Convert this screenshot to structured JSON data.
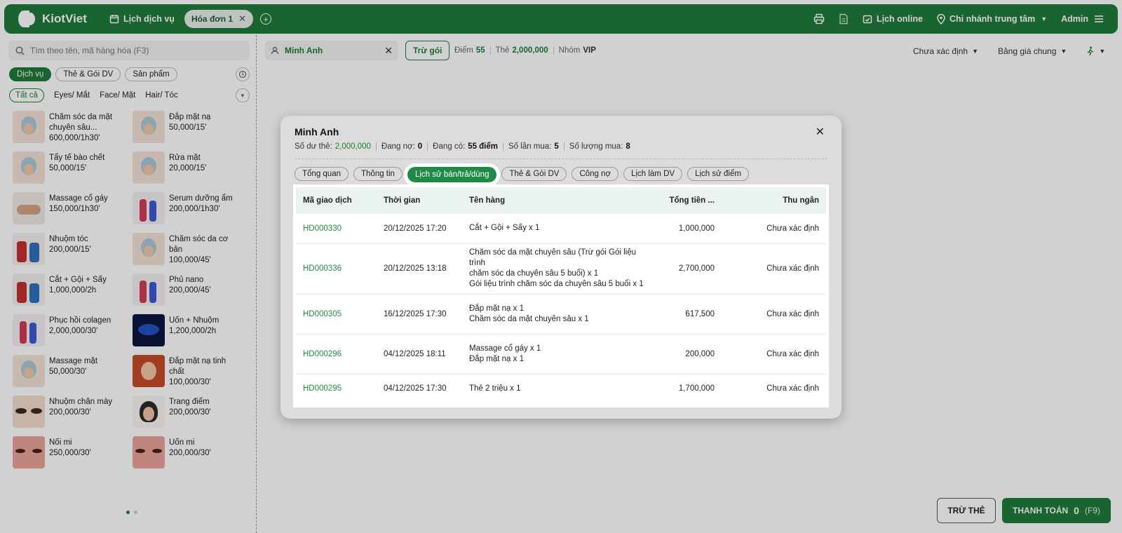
{
  "app": {
    "brand": "KiotViet",
    "service_calendar": "Lịch dịch vụ",
    "active_tab": "Hóa đơn 1",
    "online_calendar": "Lịch online",
    "branch": "Chi nhánh trung tâm",
    "user": "Admin"
  },
  "left": {
    "search_placeholder": "Tìm theo tên, mã hàng hóa (F3)",
    "categories": [
      "Dịch vụ",
      "Thẻ & Gói DV",
      "Sản phẩm"
    ],
    "subcategories": [
      "Tất cả",
      "Eyes/ Mắt",
      "Face/ Mặt",
      "Hair/ Tóc"
    ],
    "products": [
      {
        "name": "Chăm sóc da mặt chuyên sâu...",
        "price": "600,000/1h30'",
        "thumb": "t-face"
      },
      {
        "name": "Đắp mặt nạ",
        "price": "50,000/15'",
        "thumb": "t-face"
      },
      {
        "name": "Tẩy tế bào chết",
        "price": "50,000/15'",
        "thumb": "t-face"
      },
      {
        "name": "Rửa mặt",
        "price": "20,000/15'",
        "thumb": "t-face"
      },
      {
        "name": "Massage cổ gáy",
        "price": "150,000/1h30'",
        "thumb": "t-massage"
      },
      {
        "name": "Serum dưỡng ẩm",
        "price": "200,000/1h30'",
        "thumb": "t-women"
      },
      {
        "name": "Nhuộm tóc",
        "price": "200,000/15'",
        "thumb": "t-kids"
      },
      {
        "name": "Chăm sóc da cơ bản",
        "price": "100,000/45'",
        "thumb": "t-face"
      },
      {
        "name": "Cắt + Gội + Sấy",
        "price": "1,000,000/2h",
        "thumb": "t-kids"
      },
      {
        "name": "Phủ nano",
        "price": "200,000/45'",
        "thumb": "t-women"
      },
      {
        "name": "Phục hồi colagen",
        "price": "2,000,000/30'",
        "thumb": "t-women"
      },
      {
        "name": "Uốn + Nhuộm",
        "price": "1,200,000/2h",
        "thumb": "t-blue"
      },
      {
        "name": "Massage mặt",
        "price": "50,000/30'",
        "thumb": "t-face"
      },
      {
        "name": "Đắp mặt nạ tinh chất",
        "price": "100,000/30'",
        "thumb": "t-red"
      },
      {
        "name": "Nhuộm chân mày",
        "price": "200,000/30'",
        "thumb": "t-eye"
      },
      {
        "name": "Trang điểm",
        "price": "200,000/30'",
        "thumb": "t-make"
      },
      {
        "name": "Nối mi",
        "price": "250,000/30'",
        "thumb": "t-lash"
      },
      {
        "name": "Uốn mi",
        "price": "200,000/30'",
        "thumb": "t-lash"
      }
    ]
  },
  "header": {
    "customer": "Minh Anh",
    "tru_goi": "Trừ gói",
    "points_label": "Điểm",
    "points": "55",
    "card_label": "Thẻ",
    "card": "2,000,000",
    "group_label": "Nhóm",
    "group": "VIP",
    "staff": "Chưa xác định",
    "price_list": "Bảng giá chung"
  },
  "footer": {
    "tru_the": "TRỪ THẺ",
    "pay": "THANH TOÁN",
    "pay_count": "0",
    "pay_hotkey": "(F9)"
  },
  "modal": {
    "title": "Minh Anh",
    "stats": {
      "balance_label": "Số dư thẻ:",
      "balance": "2,000,000",
      "debt_label": "Đang nợ:",
      "debt": "0",
      "points_label": "Đang có:",
      "points": "55 điểm",
      "purchases_label": "Số lần mua:",
      "purchases": "5",
      "quantity_label": "Số lượng mua:",
      "quantity": "8"
    },
    "tabs": [
      "Tổng quan",
      "Thông tin",
      "Lịch sử bán/trả/dùng",
      "Thẻ & Gói DV",
      "Công nợ",
      "Lịch làm DV",
      "Lịch sử điểm"
    ],
    "active_tab_index": 2,
    "columns": [
      "Mã giao dịch",
      "Thời gian",
      "Tên hàng",
      "Tổng tiền ...",
      "Thu ngân"
    ],
    "rows": [
      {
        "code": "HD000330",
        "time": "20/12/2025 17:20",
        "items": [
          "Cắt + Gội + Sấy x 1"
        ],
        "total": "1,000,000",
        "cashier": "Chưa xác định"
      },
      {
        "code": "HD000336",
        "time": "20/12/2025 13:18",
        "items": [
          "Chăm sóc da mặt chuyên sâu (Trừ gói Gói liệu trình",
          "chăm sóc da chuyên sâu 5 buổi) x 1",
          "Gói liệu trình chăm sóc da chuyên sâu 5 buổi x 1"
        ],
        "total": "2,700,000",
        "cashier": "Chưa xác định"
      },
      {
        "code": "HD000305",
        "time": "16/12/2025 17:30",
        "items": [
          "Đắp mặt nạ x 1",
          "Chăm sóc da mặt chuyên sâu x 1"
        ],
        "total": "617,500",
        "cashier": "Chưa xác định"
      },
      {
        "code": "HD000296",
        "time": "04/12/2025 18:11",
        "items": [
          "Massage cổ gáy x 1",
          "Đắp mặt nạ x 1"
        ],
        "total": "200,000",
        "cashier": "Chưa xác định"
      },
      {
        "code": "HD000295",
        "time": "04/12/2025 17:30",
        "items": [
          "Thẻ 2 triệu x 1"
        ],
        "total": "1,700,000",
        "cashier": "Chưa xác định"
      }
    ]
  }
}
